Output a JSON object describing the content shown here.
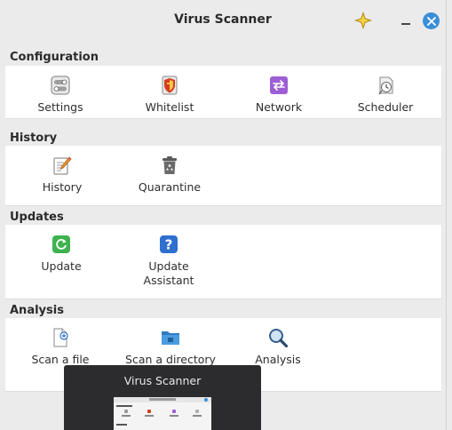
{
  "window": {
    "title": "Virus Scanner"
  },
  "sections": {
    "configuration": {
      "header": "Configuration",
      "items": [
        {
          "label": "Settings",
          "icon": "settings-toggle-icon"
        },
        {
          "label": "Whitelist",
          "icon": "whitelist-shield-icon"
        },
        {
          "label": "Network",
          "icon": "network-arrows-icon"
        },
        {
          "label": "Scheduler",
          "icon": "scheduler-clock-icon"
        }
      ]
    },
    "history": {
      "header": "History",
      "items": [
        {
          "label": "History",
          "icon": "history-notepad-icon"
        },
        {
          "label": "Quarantine",
          "icon": "quarantine-trash-icon"
        }
      ]
    },
    "updates": {
      "header": "Updates",
      "items": [
        {
          "label": "Update",
          "icon": "update-refresh-icon"
        },
        {
          "label": "Update Assistant",
          "icon": "help-question-icon"
        }
      ]
    },
    "analysis": {
      "header": "Analysis",
      "items": [
        {
          "label": "Scan a file",
          "icon": "scan-file-icon"
        },
        {
          "label": "Scan a directory",
          "icon": "folder-icon"
        },
        {
          "label": "Analysis",
          "icon": "magnifier-icon"
        }
      ]
    }
  },
  "taskbar_preview": {
    "title": "Virus Scanner"
  },
  "colors": {
    "accent": "#3a8ed9",
    "window_bg": "#ebebeb",
    "panel_bg": "#ffffff",
    "preview_bg": "#2c2c2e"
  }
}
